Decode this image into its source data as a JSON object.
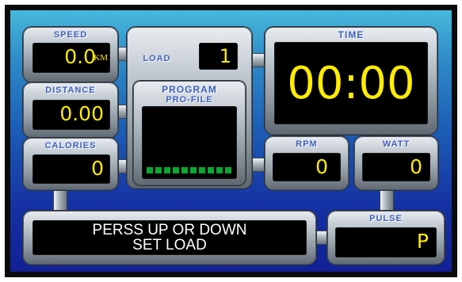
{
  "speed": {
    "label": "SPEED",
    "value": "0.0",
    "unit": "KM"
  },
  "distance": {
    "label": "DISTANCE",
    "value": "0.00"
  },
  "calories": {
    "label": "CALORIES",
    "value": "0"
  },
  "load": {
    "label": "LOAD",
    "value": "1"
  },
  "program": {
    "label_line1": "PROGRAM",
    "label_line2": "PRO-FILE",
    "bar_count": 10,
    "bar_color": "#0aa832"
  },
  "time": {
    "label": "TIME",
    "value": "00:00"
  },
  "rpm": {
    "label": "RPM",
    "value": "0"
  },
  "watt": {
    "label": "WATT",
    "value": "0"
  },
  "pulse": {
    "label": "PULSE",
    "value": "P"
  },
  "message": {
    "line1": "PERSS UP OR DOWN",
    "line2": "SET LOAD"
  },
  "colors": {
    "digit": "#ffec00",
    "label": "#3d5fb8",
    "screen_top": "#47b9dc",
    "screen_bottom": "#122096"
  }
}
